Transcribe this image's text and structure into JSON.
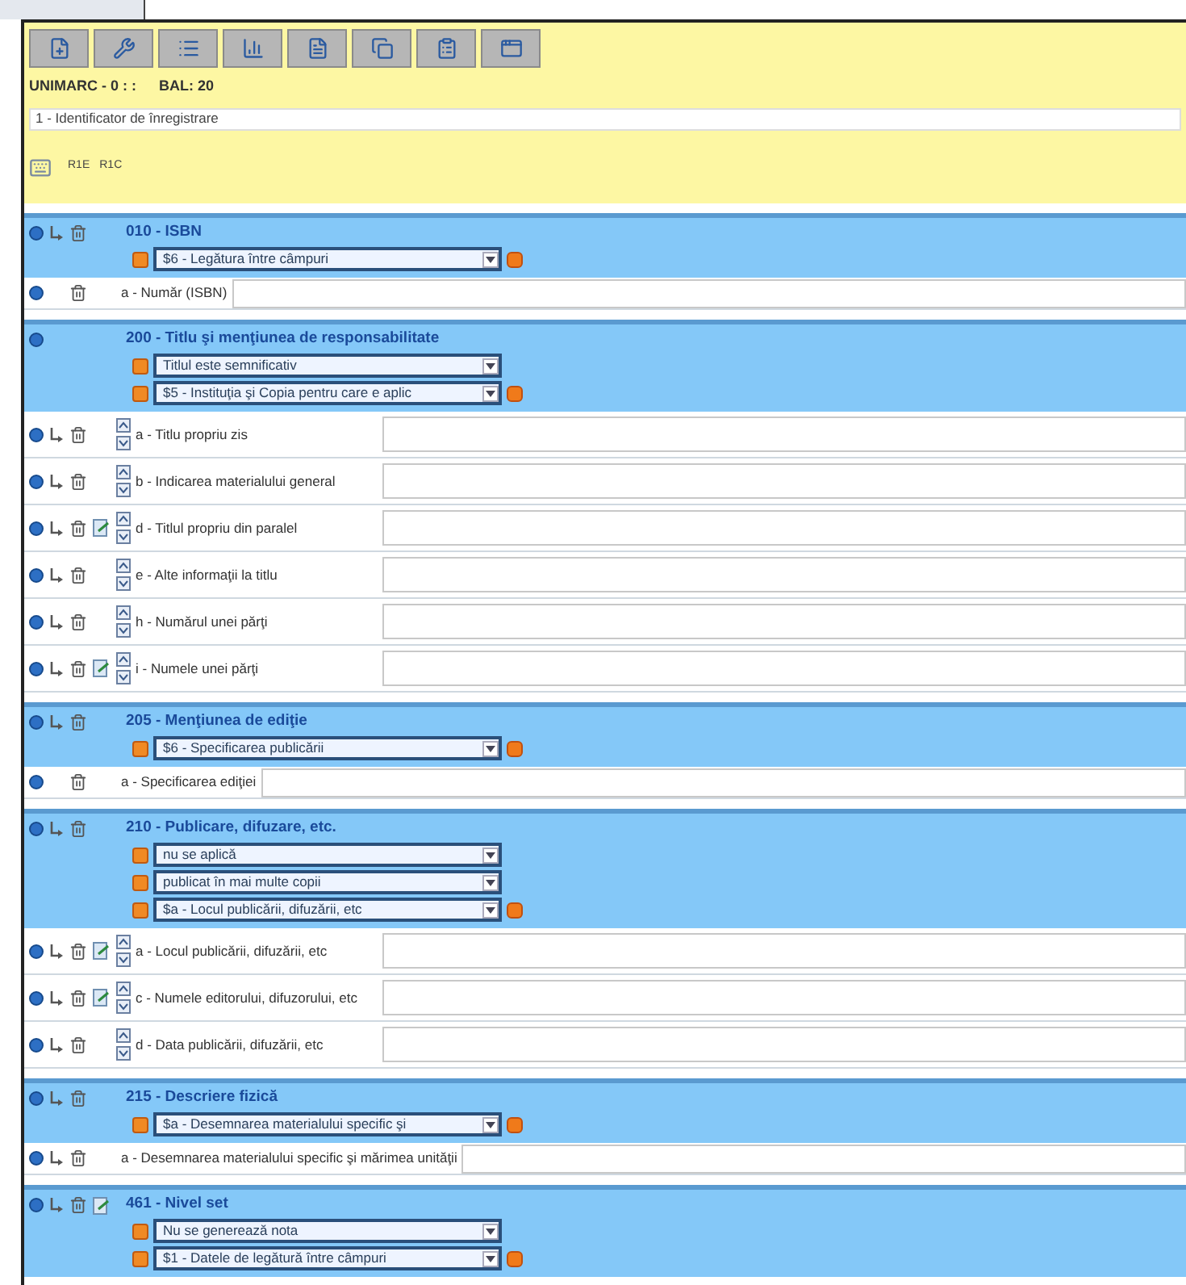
{
  "header": {
    "format": "UNIMARC - 0 : :",
    "bal": "BAL: 20",
    "record_type": "1 - Identificator de înregistrare",
    "codes": [
      "R1E",
      "R1C"
    ]
  },
  "fields": [
    {
      "title": "010 - ISBN",
      "can_repeat": true,
      "has_link": false,
      "deletable": true,
      "dropdowns": [
        {
          "value": "$6 - Legătura între câmpuri",
          "add_button": true
        }
      ],
      "subfields": [
        {
          "label": "a - Număr (ISBN)",
          "can_repeat": false,
          "has_link": false,
          "can_reorder": false
        }
      ]
    },
    {
      "title": "200 - Titlu şi menţiunea de responsabilitate",
      "can_repeat": false,
      "has_link": false,
      "deletable": false,
      "dropdowns": [
        {
          "value": "Titlul este semnificativ",
          "add_button": false
        },
        {
          "value": "$5 - Instituţia şi Copia pentru care e aplic",
          "add_button": true
        }
      ],
      "subfields": [
        {
          "label": "a - Titlu propriu zis",
          "can_repeat": true,
          "has_link": false,
          "can_reorder": true
        },
        {
          "label": "b - Indicarea materialului general",
          "can_repeat": true,
          "has_link": false,
          "can_reorder": true
        },
        {
          "label": "d - Titlul propriu din paralel",
          "can_repeat": true,
          "has_link": true,
          "can_reorder": true
        },
        {
          "label": "e - Alte informaţii la titlu",
          "can_repeat": true,
          "has_link": false,
          "can_reorder": true
        },
        {
          "label": "h - Numărul unei părţi",
          "can_repeat": true,
          "has_link": false,
          "can_reorder": true
        },
        {
          "label": "i - Numele unei părţi",
          "can_repeat": true,
          "has_link": true,
          "can_reorder": true
        }
      ]
    },
    {
      "title": "205 - Menţiunea de ediţie",
      "can_repeat": true,
      "has_link": false,
      "deletable": true,
      "dropdowns": [
        {
          "value": "$6 - Specificarea publicării",
          "add_button": true
        }
      ],
      "subfields": [
        {
          "label": "a - Specificarea ediţiei",
          "can_repeat": false,
          "has_link": false,
          "can_reorder": false
        }
      ]
    },
    {
      "title": "210 - Publicare, difuzare, etc.",
      "can_repeat": true,
      "has_link": false,
      "deletable": true,
      "dropdowns": [
        {
          "value": "nu se aplică",
          "add_button": false
        },
        {
          "value": "publicat în mai multe copii",
          "add_button": false
        },
        {
          "value": "$a - Locul publicării, difuzării, etc",
          "add_button": true
        }
      ],
      "subfields": [
        {
          "label": "a - Locul publicării, difuzării, etc",
          "can_repeat": true,
          "has_link": true,
          "can_reorder": true
        },
        {
          "label": "c - Numele editorului, difuzorului, etc",
          "can_repeat": true,
          "has_link": true,
          "can_reorder": true
        },
        {
          "label": "d - Data publicării, difuzării, etc",
          "can_repeat": true,
          "has_link": false,
          "can_reorder": true
        }
      ]
    },
    {
      "title": "215 - Descriere fizică",
      "can_repeat": true,
      "has_link": false,
      "deletable": true,
      "dropdowns": [
        {
          "value": "$a - Desemnarea materialului specific şi",
          "add_button": true
        }
      ],
      "subfields": [
        {
          "label": "a - Desemnarea materialului specific şi mărimea unităţii",
          "can_repeat": true,
          "has_link": false,
          "can_reorder": false
        }
      ]
    },
    {
      "title": "461 - Nivel set",
      "can_repeat": true,
      "has_link": true,
      "deletable": true,
      "dropdowns": [
        {
          "value": "Nu se generează nota",
          "add_button": false
        },
        {
          "value": "$1 - Datele de legătură între câmpuri",
          "add_button": true
        }
      ]
    }
  ]
}
